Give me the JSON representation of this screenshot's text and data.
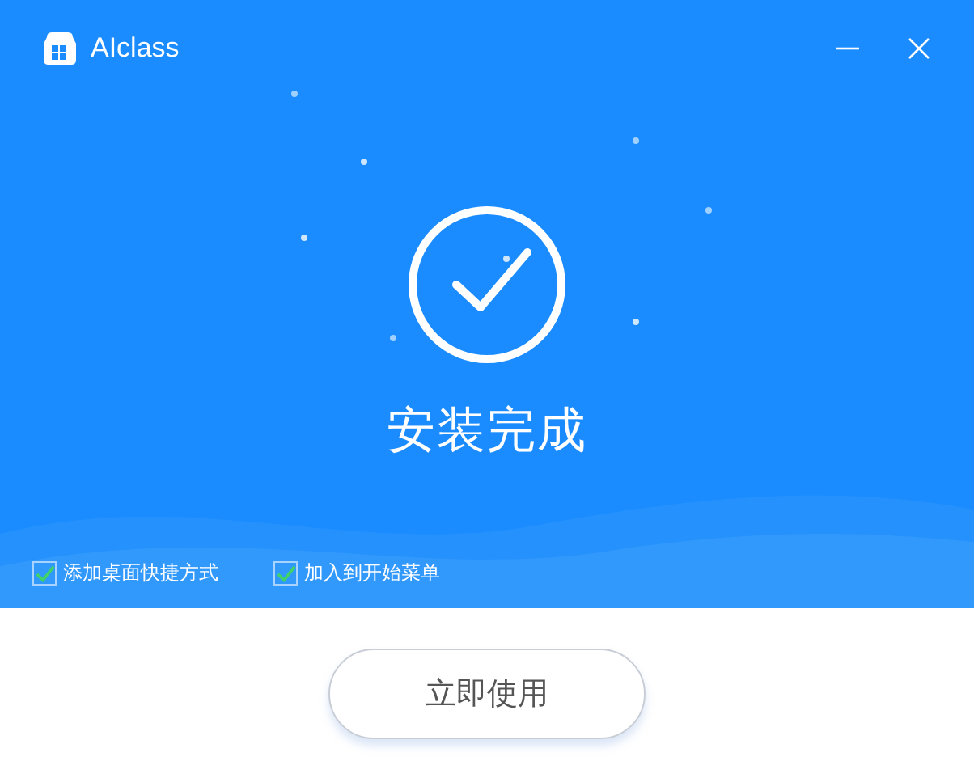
{
  "window": {
    "title": "AIclass"
  },
  "status": {
    "title": "安装完成"
  },
  "options": [
    {
      "label": "添加桌面快捷方式",
      "checked": true
    },
    {
      "label": "加入到开始菜单",
      "checked": true
    }
  ],
  "primary_button": {
    "label": "立即使用"
  }
}
